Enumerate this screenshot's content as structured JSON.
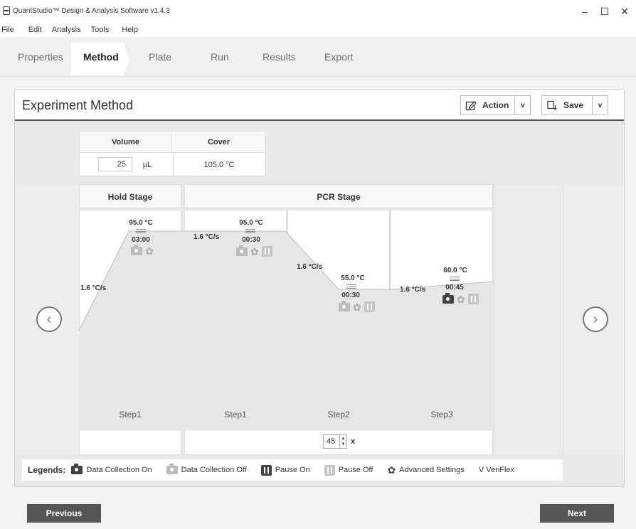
{
  "window": {
    "title": "QuantStudio™ Design & Analysis Software v1.4.3",
    "minimize": "–",
    "maximize": "☐",
    "close": "✕"
  },
  "menu": [
    "File",
    "Edit",
    "Analysis",
    "Tools",
    "Help"
  ],
  "tabs": [
    "Properties",
    "Method",
    "Plate",
    "Run",
    "Results",
    "Export"
  ],
  "active_tab": "Method",
  "panel": {
    "title": "Experiment Method",
    "action_label": "Action",
    "save_label": "Save",
    "caret": "v"
  },
  "volume_table": {
    "volume_header": "Volume",
    "cover_header": "Cover",
    "volume_value": "25",
    "volume_unit": "µL",
    "cover_value": "105.0 °C"
  },
  "stages": {
    "hold": {
      "name": "Hold Stage",
      "step": {
        "label": "Step1",
        "temp": "95.0 °C",
        "time": "03:00",
        "rate": "1.6 °C/s"
      }
    },
    "pcr": {
      "name": "PCR Stage",
      "cycles": "45",
      "cycles_suffix": "x",
      "steps": [
        {
          "label": "Step1",
          "temp": "95.0 °C",
          "time": "00:30",
          "rate": "1.6 °C/s"
        },
        {
          "label": "Step2",
          "temp": "55.0 °C",
          "time": "00:30",
          "rate": "1.6 °C/s"
        },
        {
          "label": "Step3",
          "temp": "60.0 °C",
          "time": "00:45",
          "rate": "1.6 °C/s"
        }
      ]
    }
  },
  "legend": {
    "title": "Legends:",
    "data_on": "Data Collection On",
    "data_off": "Data Collection Off",
    "pause_on": "Pause On",
    "pause_off": "Pause Off",
    "advanced": "Advanced Settings",
    "veriflex": "V VeriFlex"
  },
  "buttons": {
    "previous": "Previous",
    "next": "Next"
  },
  "colors": {
    "data_on": "#444444",
    "data_off": "#bbbbbb",
    "pause_on": "#444444",
    "pause_off": "#c4c4c4",
    "profile_fill": "#e6e6e6"
  }
}
